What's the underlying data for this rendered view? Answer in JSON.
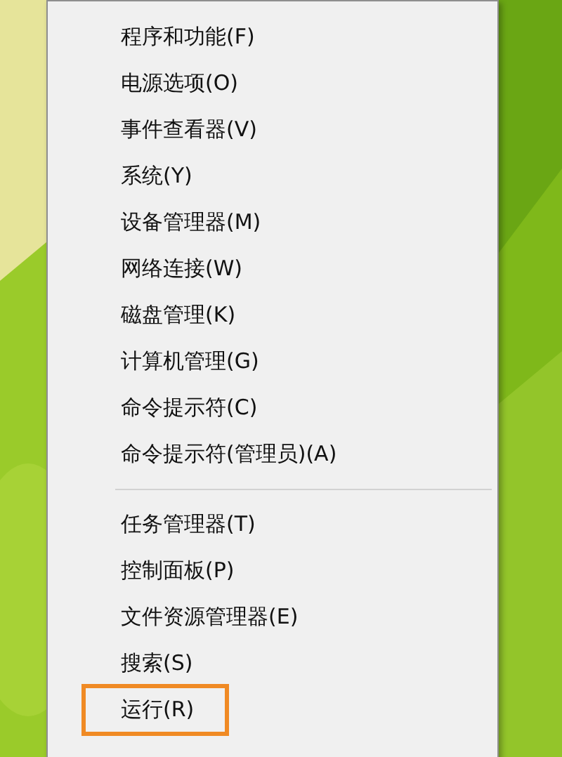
{
  "menu": {
    "groups": [
      {
        "items": [
          {
            "label": "程序和功能(F)",
            "highlighted": false
          },
          {
            "label": "电源选项(O)",
            "highlighted": false
          },
          {
            "label": "事件查看器(V)",
            "highlighted": false
          },
          {
            "label": "系统(Y)",
            "highlighted": false
          },
          {
            "label": "设备管理器(M)",
            "highlighted": false
          },
          {
            "label": "网络连接(W)",
            "highlighted": false
          },
          {
            "label": "磁盘管理(K)",
            "highlighted": false
          },
          {
            "label": "计算机管理(G)",
            "highlighted": false
          },
          {
            "label": "命令提示符(C)",
            "highlighted": false
          },
          {
            "label": "命令提示符(管理员)(A)",
            "highlighted": false
          }
        ]
      },
      {
        "items": [
          {
            "label": "任务管理器(T)",
            "highlighted": false
          },
          {
            "label": "控制面板(P)",
            "highlighted": false
          },
          {
            "label": "文件资源管理器(E)",
            "highlighted": false
          },
          {
            "label": "搜索(S)",
            "highlighted": false
          },
          {
            "label": "运行(R)",
            "highlighted": true
          }
        ]
      }
    ]
  }
}
